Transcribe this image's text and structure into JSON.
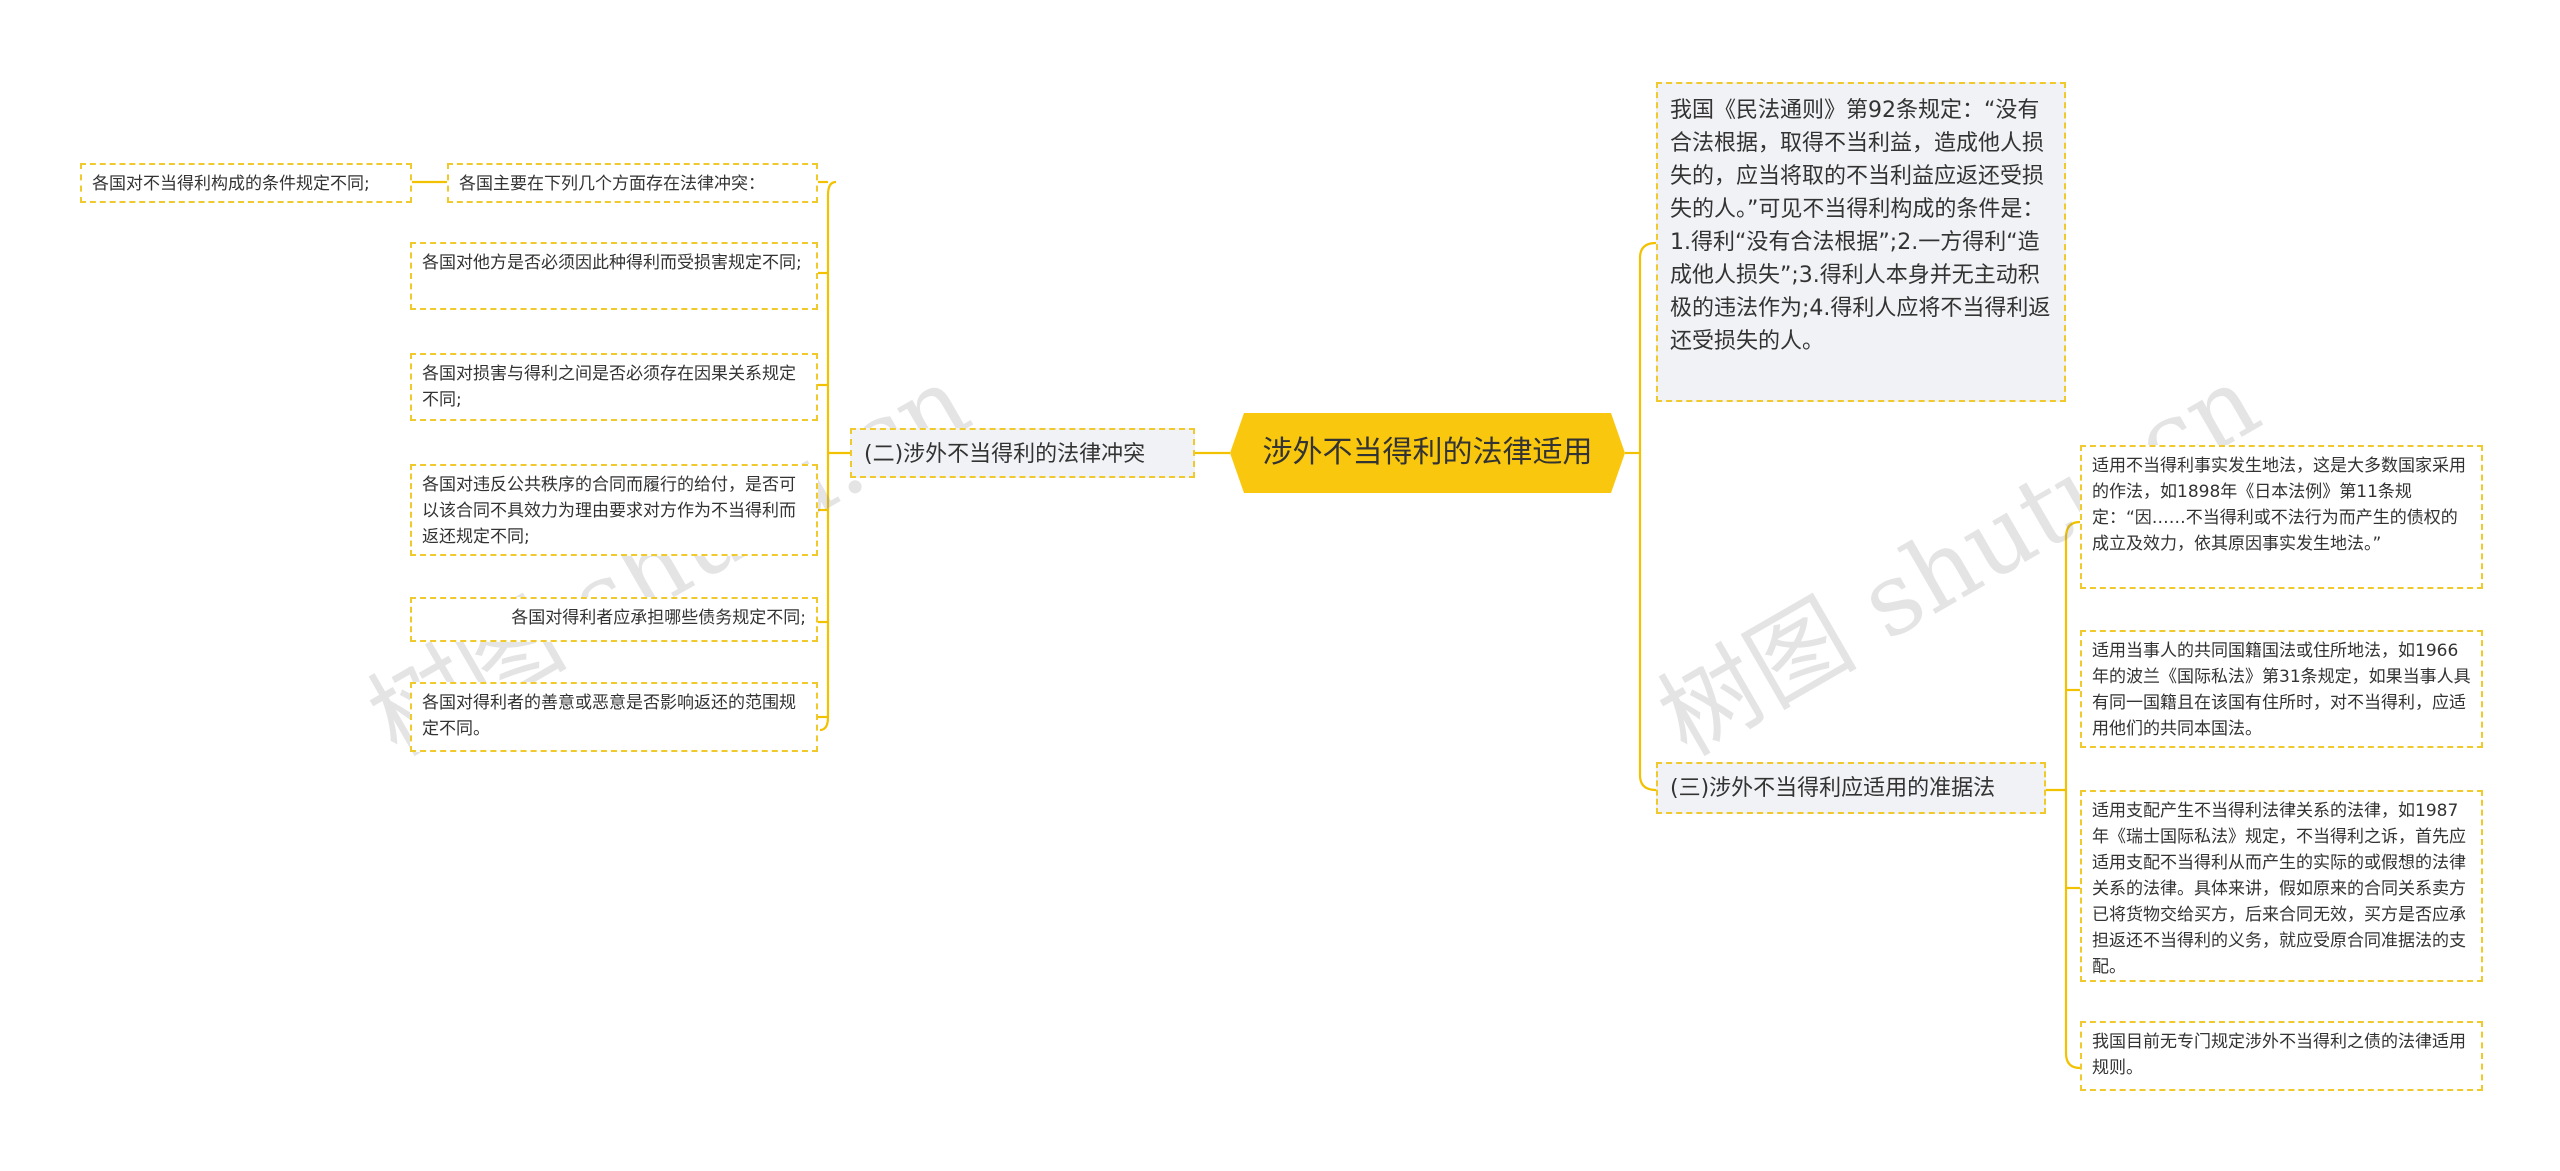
{
  "root": {
    "title": "涉外不当得利的法律适用"
  },
  "left": {
    "branch": "(二)涉外不当得利的法律冲突",
    "intro": "各国主要在下列几个方面存在法律冲突：",
    "intro_child": "各国对不当得利构成的条件规定不同;",
    "items": [
      "各国对他方是否必须因此种得利而受损害规定不同;",
      "各国对损害与得利之间是否必须存在因果关系规定不同;",
      "各国对违反公共秩序的合同而履行的给付，是否可以该合同不具效力为理由要求对方作为不当得利而返还规定不同;",
      "各国对得利者应承担哪些债务规定不同;",
      "各国对得利者的善意或恶意是否影响返还的范围规定不同。"
    ]
  },
  "right": {
    "top_text": "我国《民法通则》第92条规定：“没有合法根据，取得不当利益，造成他人损失的，应当将取的不当利益应返还受损失的人。”可见不当得利构成的条件是：1.得利“没有合法根据”;2.一方得利“造成他人损失”;3.得利人本身并无主动积极的违法作为;4.得利人应将不当得利返还受损失的人。",
    "branch": "(三)涉外不当得利应适用的准据法",
    "items": [
      "适用不当得利事实发生地法，这是大多数国家采用的作法，如1898年《日本法例》第11条规定：“因……不当得利或不法行为而产生的债权的成立及效力，依其原因事实发生地法。”",
      "适用当事人的共同国籍国法或住所地法，如1966年的波兰《国际私法》第31条规定，如果当事人具有同一国籍且在该国有住所时，对不当得利，应适用他们的共同本国法。",
      "适用支配产生不当得利法律关系的法律，如1987年《瑞士国际私法》规定，不当得利之诉，首先应适用支配不当得利从而产生的实际的或假想的法律关系的法律。具体来讲，假如原来的合同关系卖方已将货物交给买方，后来合同无效，买方是否应承担返还不当得利的义务，就应受原合同准据法的支配。",
      "我国目前无专门规定涉外不当得利之债的法律适用规则。"
    ]
  },
  "watermark": [
    "树图 shutu.cn",
    "树图 shutu.cn"
  ]
}
